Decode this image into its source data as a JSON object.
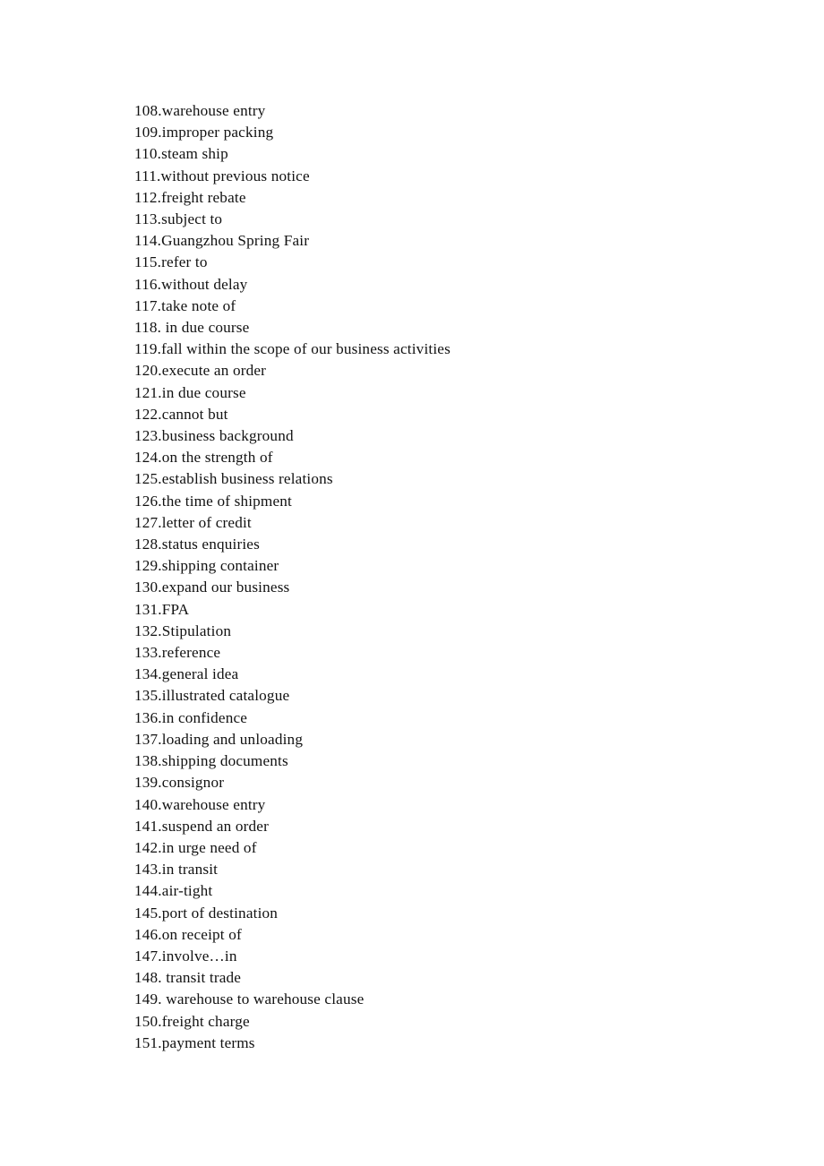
{
  "document": {
    "type": "glossary-term-list",
    "language": "en",
    "background_color": "#ffffff",
    "text_color": "#121212",
    "first_item_number": 108,
    "last_item_number": 151,
    "item_count": 44,
    "entries": [
      "108.warehouse entry",
      "109.improper packing",
      "110.steam ship",
      "111.without previous notice",
      "112.freight rebate",
      "113.subject to",
      "114.Guangzhou Spring Fair",
      "115.refer to",
      "116.without delay",
      "117.take note of",
      "118. in due course",
      "119.fall within the scope of our business activities",
      "120.execute an order",
      "121.in due course",
      "122.cannot but",
      "123.business background",
      "124.on the strength of",
      "125.establish business relations",
      "126.the time of shipment",
      "127.letter of credit",
      "128.status enquiries",
      "129.shipping container",
      "130.expand our business",
      "131.FPA",
      "132.Stipulation",
      "133.reference",
      "134.general idea",
      "135.illustrated catalogue",
      "136.in confidence",
      "137.loading and unloading",
      "138.shipping documents",
      "139.consignor",
      "140.warehouse entry",
      "141.suspend an order",
      "142.in urge need of",
      "143.in transit",
      "144.air-tight",
      "145.port of destination",
      "146.on receipt of",
      "147.involve…in",
      "148. transit trade",
      "149. warehouse to warehouse clause",
      "150.freight charge",
      "151.payment terms"
    ]
  }
}
